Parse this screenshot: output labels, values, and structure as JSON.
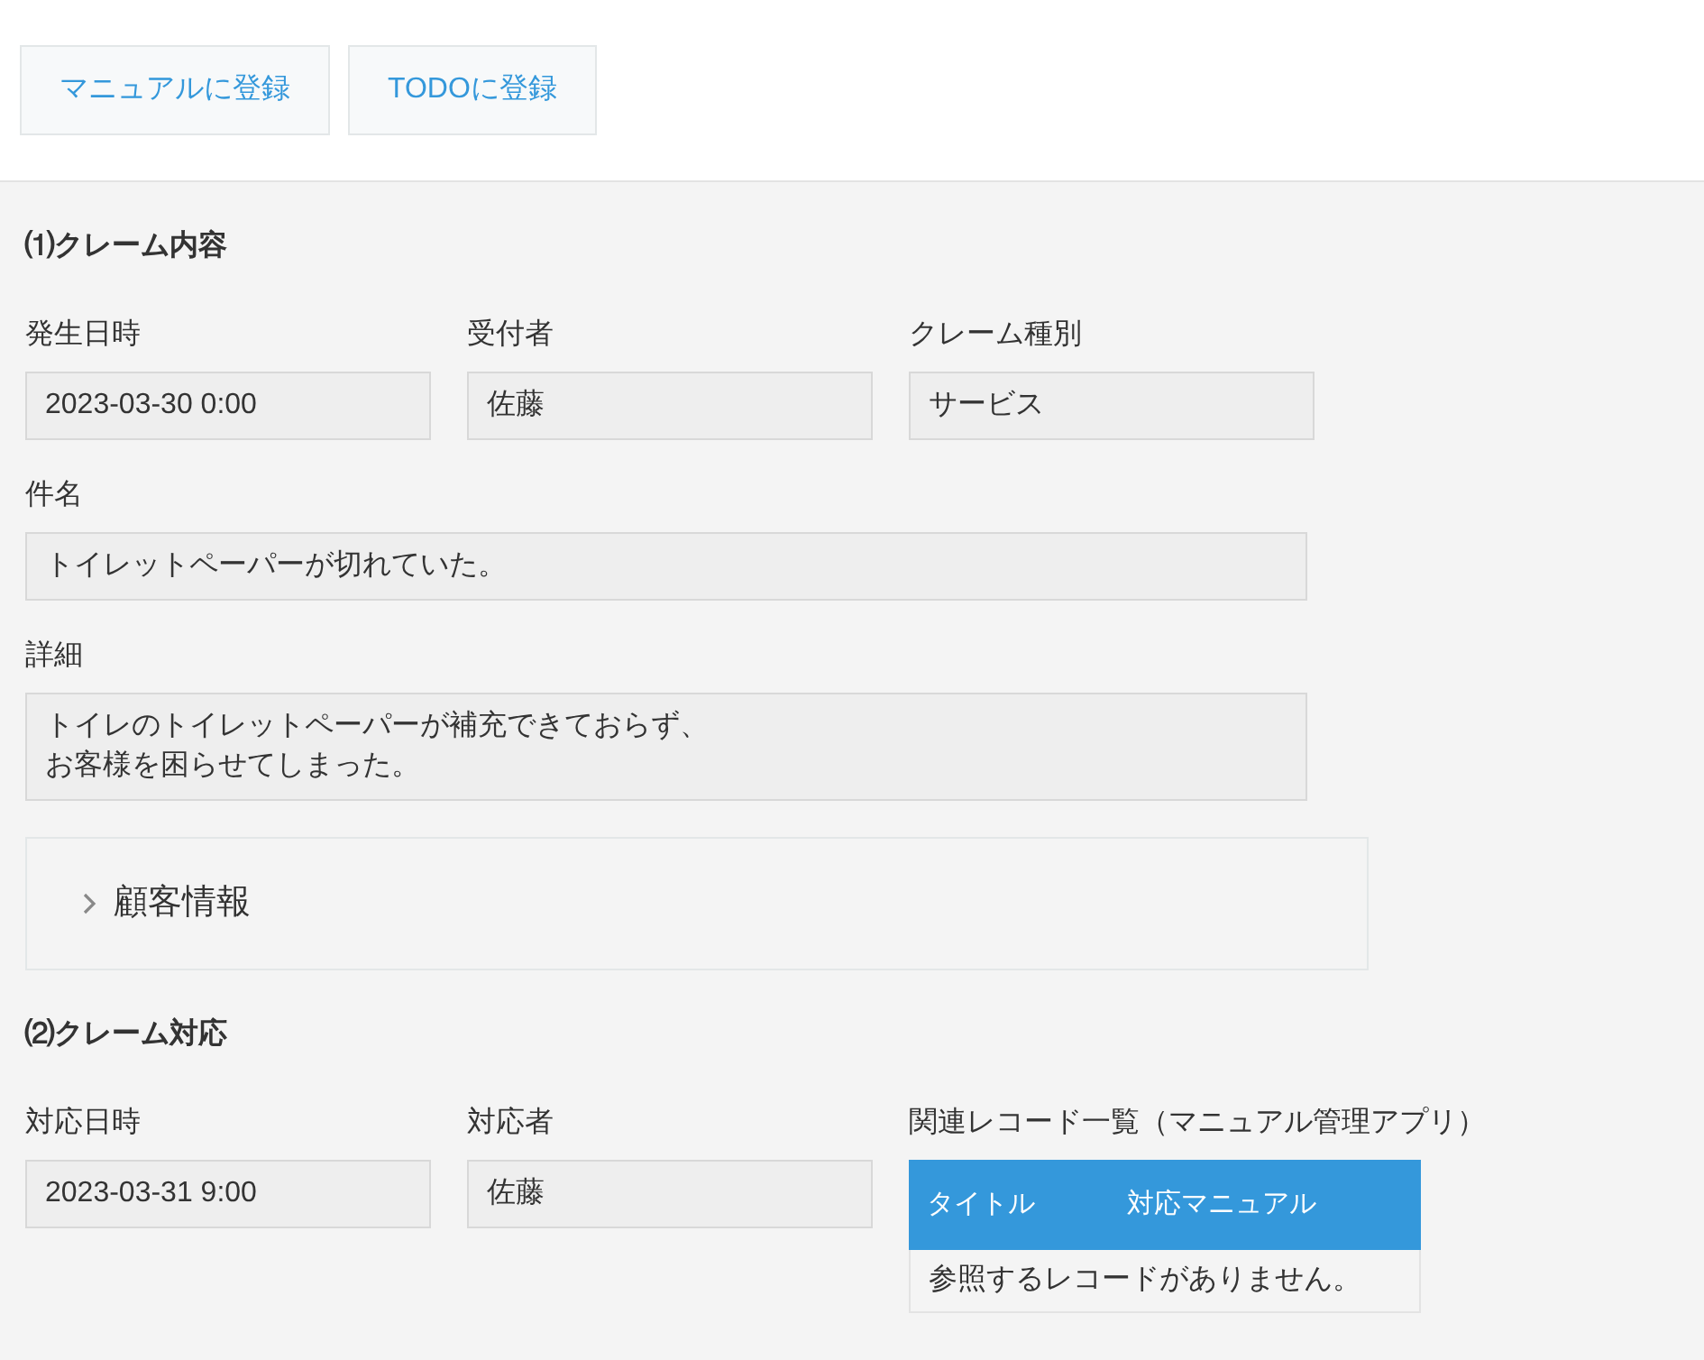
{
  "toolbar": {
    "buttons": [
      "マニュアルに登録",
      "TODOに登録"
    ]
  },
  "sections": [
    {
      "title": "⑴クレーム内容",
      "items": [
        {
          "kind": "fields",
          "fields": [
            {
              "label": "発生日時",
              "value": "2023-03-30 0:00"
            },
            {
              "label": "受付者",
              "value": "佐藤"
            },
            {
              "label": "クレーム種別",
              "value": "サービス"
            }
          ]
        },
        {
          "kind": "fields",
          "fields": [
            {
              "label": "件名",
              "value": "トイレットペーパーが切れていた。"
            }
          ]
        },
        {
          "kind": "fields",
          "fields": [
            {
              "label": "詳細",
              "lines": [
                "トイレのトイレットペーパーが補充できておらず、",
                "お客様を困らせてしまった。"
              ]
            }
          ]
        },
        {
          "kind": "group",
          "label": "顧客情報",
          "expanded": false
        }
      ]
    },
    {
      "title": "⑵クレーム対応",
      "items": [
        {
          "kind": "fields",
          "fields": [
            {
              "label": "対応日時",
              "value": "2023-03-31 9:00"
            },
            {
              "label": "対応者",
              "value": "佐藤"
            }
          ],
          "related": {
            "label": "関連レコード一覧（マニュアル管理アプリ）",
            "columns": [
              "タイトル",
              "対応マニュアル"
            ],
            "empty_message": "参照するレコードがありません。"
          }
        }
      ]
    }
  ]
}
